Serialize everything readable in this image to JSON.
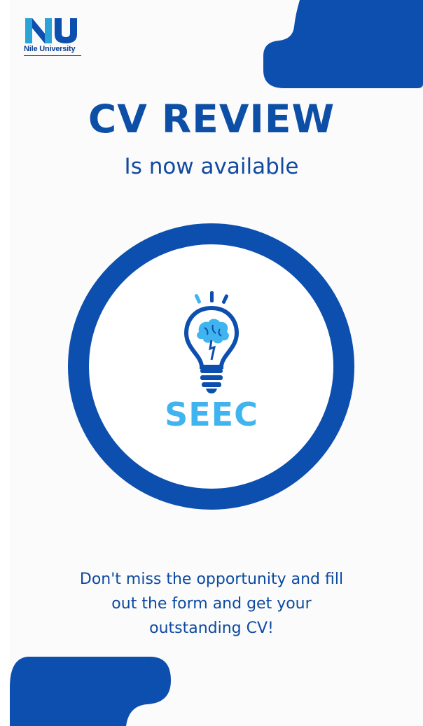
{
  "brand": {
    "logo_text": "Nile University",
    "icon": "nu-logo-icon"
  },
  "poster": {
    "title": "CV REVIEW",
    "subtitle": "Is now available",
    "emblem": {
      "icon": "lightbulb-brain-icon",
      "label": "SEEC"
    },
    "message_lines": [
      "Don't miss the opportunity and fill",
      "out the form and get your",
      "outstanding CV!"
    ]
  },
  "colors": {
    "primary_blue": "#0d4fae",
    "accent_light_blue": "#40b4ef",
    "logo_teal": "#2aa3d8",
    "background": "#fbfbfb"
  }
}
